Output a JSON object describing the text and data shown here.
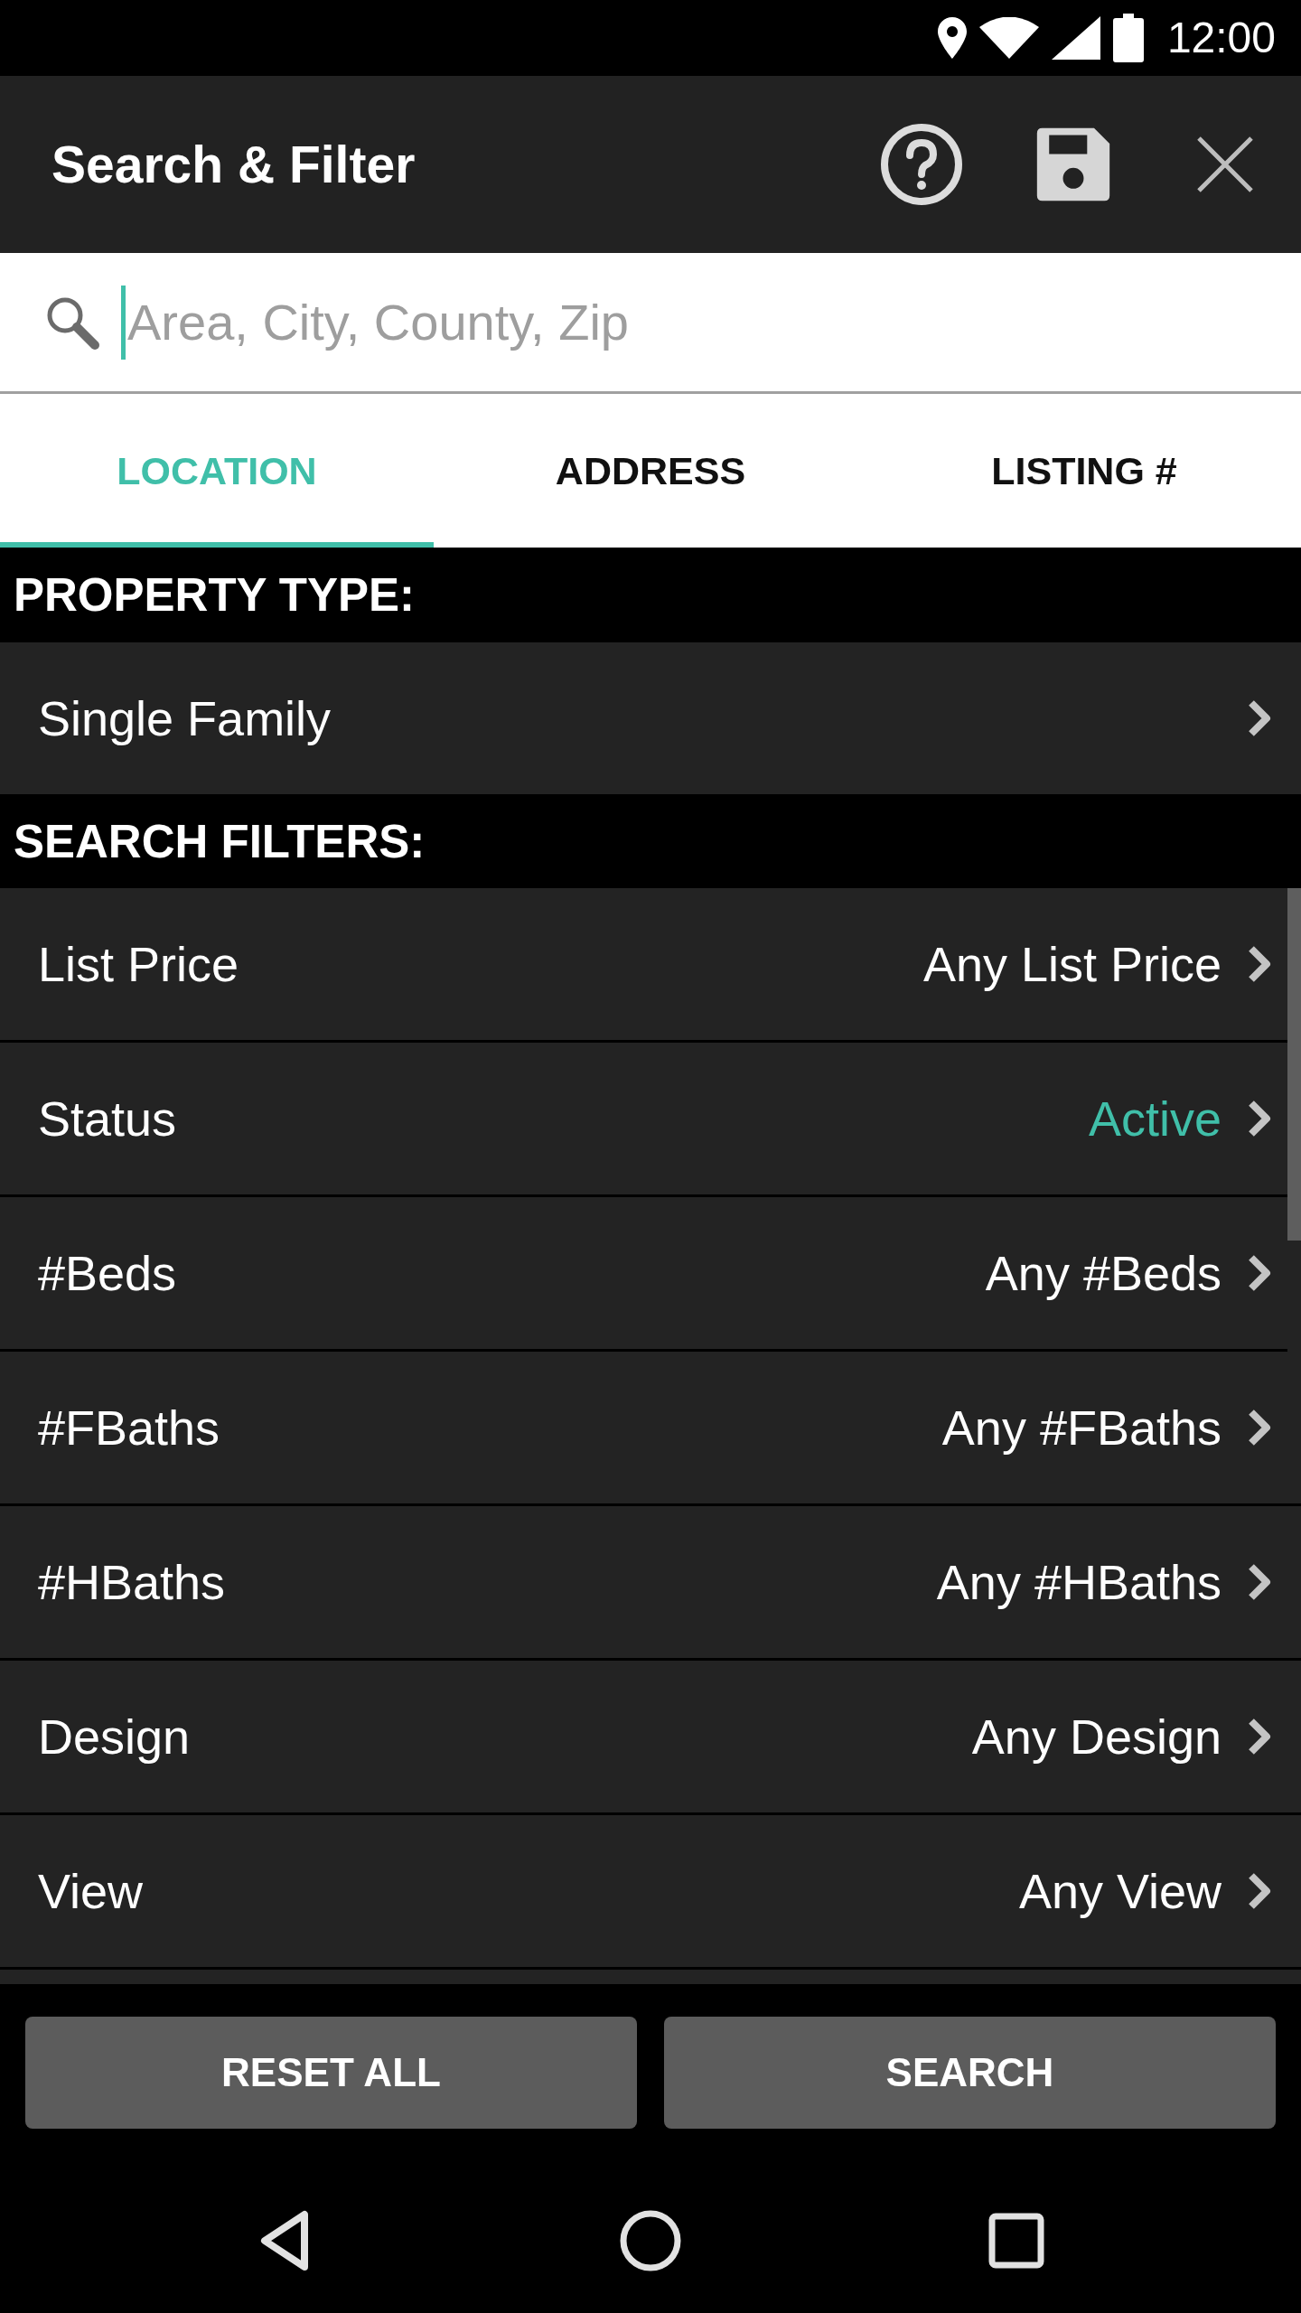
{
  "status_bar": {
    "time": "12:00"
  },
  "toolbar": {
    "title": "Search & Filter"
  },
  "search": {
    "placeholder": "Area, City, County, Zip"
  },
  "tabs": [
    {
      "label": "LOCATION",
      "selected": true
    },
    {
      "label": "ADDRESS",
      "selected": false
    },
    {
      "label": "LISTING #",
      "selected": false
    }
  ],
  "sections": [
    {
      "heading": "PROPERTY TYPE:",
      "rows": [
        {
          "label": "Single Family"
        }
      ]
    },
    {
      "heading": "SEARCH FILTERS:",
      "rows": [
        {
          "label": "List Price",
          "value": "Any List Price",
          "highlighted": false
        },
        {
          "label": "Status",
          "value": "Active",
          "highlighted": true
        },
        {
          "label": "#Beds",
          "value": "Any #Beds",
          "highlighted": false
        },
        {
          "label": "#FBaths",
          "value": "Any #FBaths",
          "highlighted": false
        },
        {
          "label": "#HBaths",
          "value": "Any #HBaths",
          "highlighted": false
        },
        {
          "label": "Design",
          "value": "Any Design",
          "highlighted": false
        },
        {
          "label": "View",
          "value": "Any View",
          "highlighted": false
        }
      ]
    }
  ],
  "buttons": [
    {
      "label": "RESET ALL"
    },
    {
      "label": "SEARCH"
    }
  ]
}
